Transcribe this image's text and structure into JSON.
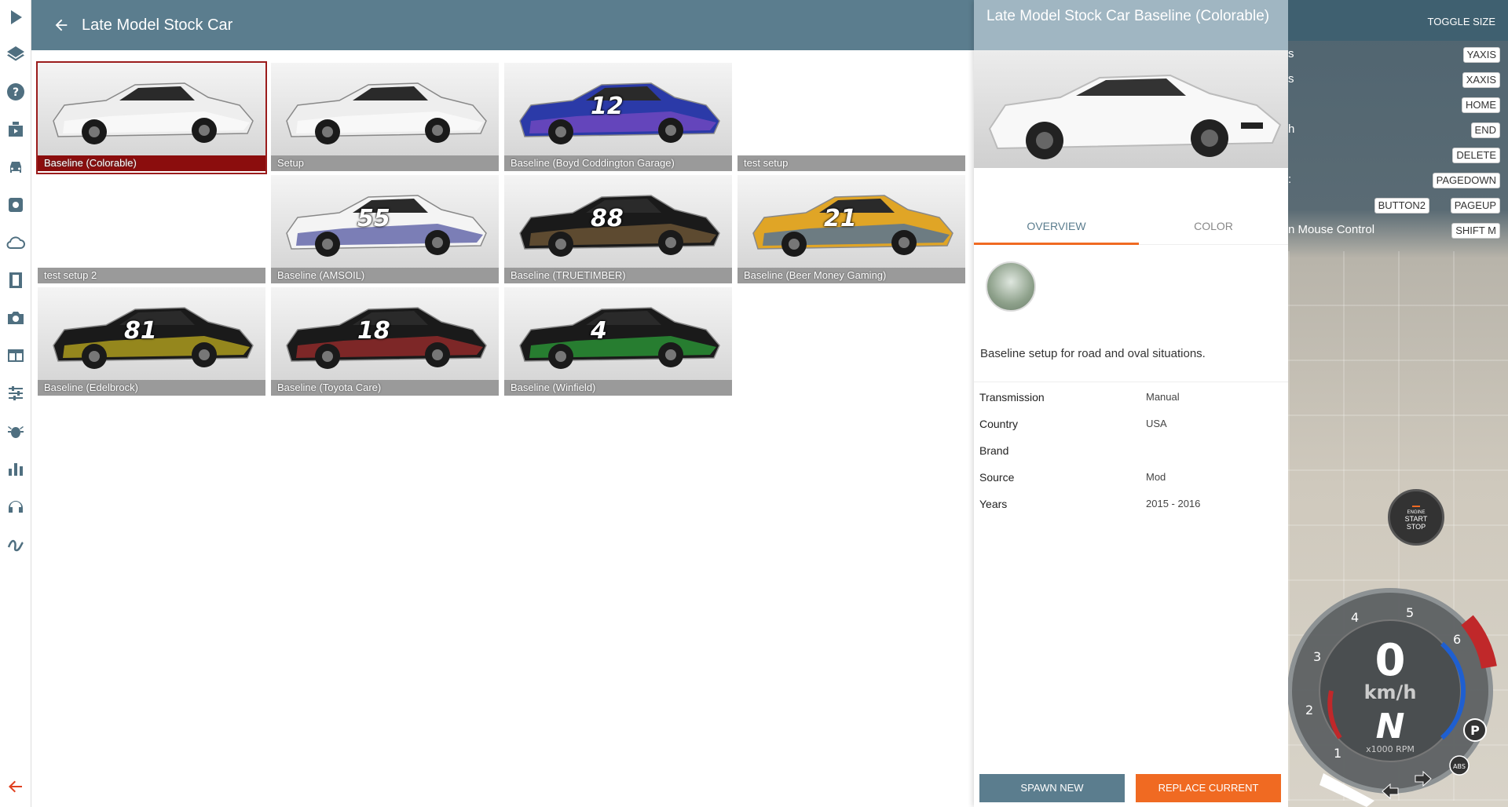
{
  "sidebar": {
    "items": [
      {
        "icon": "play-icon"
      },
      {
        "icon": "layers-icon"
      },
      {
        "icon": "help-icon"
      },
      {
        "icon": "clapperboard-icon"
      },
      {
        "icon": "car-icon"
      },
      {
        "icon": "settings-icon"
      },
      {
        "icon": "cloud-icon"
      },
      {
        "icon": "film-icon"
      },
      {
        "icon": "camera-icon"
      },
      {
        "icon": "window-icon"
      },
      {
        "icon": "sliders-icon"
      },
      {
        "icon": "bug-icon"
      },
      {
        "icon": "bar-chart-icon"
      },
      {
        "icon": "headphones-icon"
      },
      {
        "icon": "squiggle-icon"
      },
      {
        "icon": "arrow-left-icon"
      }
    ]
  },
  "header": {
    "title": "Late Model Stock Car"
  },
  "configs": [
    {
      "label": "Baseline (Colorable)",
      "livery": "#eeeeee",
      "accent": "#ffffff",
      "number": "",
      "selected": true
    },
    {
      "label": "Setup",
      "livery": "#eeeeee",
      "accent": "#ffffff",
      "number": "",
      "selected": false
    },
    {
      "label": "Baseline (Boyd Coddington Garage)",
      "livery": "#2b3aa8",
      "accent": "#8a4cc8",
      "number": "12",
      "selected": false
    },
    {
      "label": "test setup",
      "livery": "",
      "accent": "",
      "number": "",
      "selected": false
    },
    {
      "label": "test setup 2",
      "livery": "",
      "accent": "",
      "number": "",
      "selected": false
    },
    {
      "label": "Baseline (AMSOIL)",
      "livery": "#f4f4f4",
      "accent": "#2a2f8c",
      "number": "55",
      "selected": false
    },
    {
      "label": "Baseline (TRUETIMBER)",
      "livery": "#1a1a1a",
      "accent": "#8a6a40",
      "number": "88",
      "selected": false
    },
    {
      "label": "Baseline (Beer Money Gaming)",
      "livery": "#e0a526",
      "accent": "#2060c0",
      "number": "21",
      "selected": false
    },
    {
      "label": "Baseline (Edelbrock)",
      "livery": "#1a1a1a",
      "accent": "#e8d020",
      "number": "81",
      "selected": false
    },
    {
      "label": "Baseline (Toyota Care)",
      "livery": "#1a1a1a",
      "accent": "#c03030",
      "number": "18",
      "selected": false
    },
    {
      "label": "Baseline (Winfield)",
      "livery": "#1a1a1a",
      "accent": "#30c040",
      "number": "4",
      "selected": false
    }
  ],
  "detail": {
    "title": "Late Model Stock Car Baseline (Colorable)",
    "tabs": [
      {
        "label": "OVERVIEW",
        "active": true
      },
      {
        "label": "COLOR",
        "active": false
      }
    ],
    "description": "Baseline setup for road and oval situations.",
    "properties": [
      {
        "key": "Transmission",
        "value": "Manual"
      },
      {
        "key": "Country",
        "value": "USA"
      },
      {
        "key": "Brand",
        "value": ""
      },
      {
        "key": "Source",
        "value": "Mod"
      },
      {
        "key": "Years",
        "value": "2015 - 2016"
      }
    ],
    "spawn_label": "SPAWN NEW",
    "replace_label": "REPLACE CURRENT"
  },
  "game": {
    "toggle_size": "TOGGLE SIZE",
    "hints": [
      {
        "key": "YAXIS",
        "label": "s"
      },
      {
        "key": "XAXIS",
        "label": "s"
      },
      {
        "key": "HOME",
        "label": ""
      },
      {
        "key": "END",
        "label": "h"
      },
      {
        "key": "DELETE",
        "label": ""
      },
      {
        "key": "PAGEDOWN",
        "label": ":"
      },
      {
        "key": "PAGEUP",
        "label": ""
      },
      {
        "key": "SHIFT M",
        "label": "n Mouse Control"
      }
    ],
    "extra_key": "BUTTON2",
    "engine_line1": "ENGINE",
    "engine_line2": "START",
    "engine_line3": "STOP",
    "speed": "0",
    "speed_unit": "km/h",
    "gear": "N",
    "rpm_unit": "x1000 RPM",
    "rpm_ticks": [
      "1",
      "2",
      "3",
      "4",
      "5",
      "6"
    ],
    "colors": {
      "accent": "#f06a22",
      "header": "#5b7d8e",
      "selected": "#8b0d0d"
    }
  }
}
